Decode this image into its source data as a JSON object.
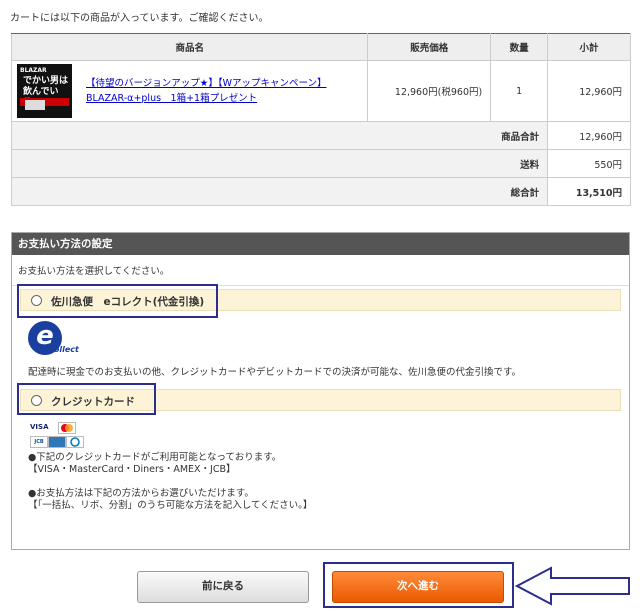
{
  "intro": "カートには以下の商品が入っています。ご確認ください。",
  "cart": {
    "headers": [
      "商品名",
      "販売価格",
      "数量",
      "小計"
    ],
    "item": {
      "thumb_logo": "BLAZAR",
      "thumb_line1": "でかい男は",
      "thumb_line2": "飲んでいる!!",
      "name_line1": "【待望のバージョンアップ★】【Wアップキャンペーン】",
      "name_line2": "BLAZAR-α+plus　1箱+1箱プレゼント",
      "price": "12,960円(税960円)",
      "qty": "1",
      "subtotal": "12,960円"
    },
    "summary": [
      {
        "label": "商品合計",
        "value": "12,960円"
      },
      {
        "label": "送料",
        "value": "550円"
      },
      {
        "label": "総合計",
        "value": "13,510円"
      }
    ]
  },
  "payment": {
    "title": "お支払い方法の設定",
    "instruction": "お支払い方法を選択してください。",
    "option1": {
      "label": "佐川急便　eコレクト(代金引換)",
      "logo_letter": "e",
      "logo_text": "Collect",
      "description": "配達時に現金でのお支払いの他、クレジットカードやデビットカードでの決済が可能な、佐川急便の代金引換です。"
    },
    "option2": {
      "label": "クレジットカード",
      "card_visa": "VISA",
      "card_jcb": "JCB",
      "note1": "●下記のクレジットカードがご利用可能となっております。",
      "note2": "【VISA・MasterCard・Diners・AMEX・JCB】",
      "note3": "●お支払方法は下記の方法からお選びいただけます。",
      "note4": "【「一括払、リボ、分割」のうち可能な方法を記入してください。】"
    }
  },
  "buttons": {
    "back": "前に戻る",
    "next": "次へ進む"
  },
  "colors": {
    "highlight": "#2d2d8e",
    "next_button": "#ea5a00",
    "option_bg": "#fdf4d8"
  }
}
